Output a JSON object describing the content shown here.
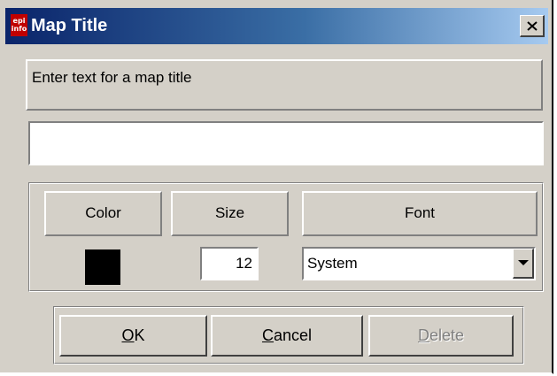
{
  "window": {
    "title": "Map Title",
    "app_icon_text": "epi info",
    "close_glyph": "×"
  },
  "prompt": {
    "text": "Enter text for a map title"
  },
  "title_input": {
    "value": "",
    "placeholder": ""
  },
  "style_group": {
    "color_header": "Color",
    "size_header": "Size",
    "font_header": "Font",
    "color_value": "#000000",
    "size_value": "12",
    "font_value": "System"
  },
  "buttons": {
    "ok_access": "O",
    "ok_rest": "K",
    "cancel_access": "C",
    "cancel_rest": "ancel",
    "delete_access": "D",
    "delete_rest": "elete",
    "delete_enabled": false
  },
  "colors": {
    "titlebar_start": "#0a246a",
    "titlebar_end": "#a6caf0",
    "dialog_bg": "#d4d0c8",
    "icon_red": "#c00000"
  }
}
